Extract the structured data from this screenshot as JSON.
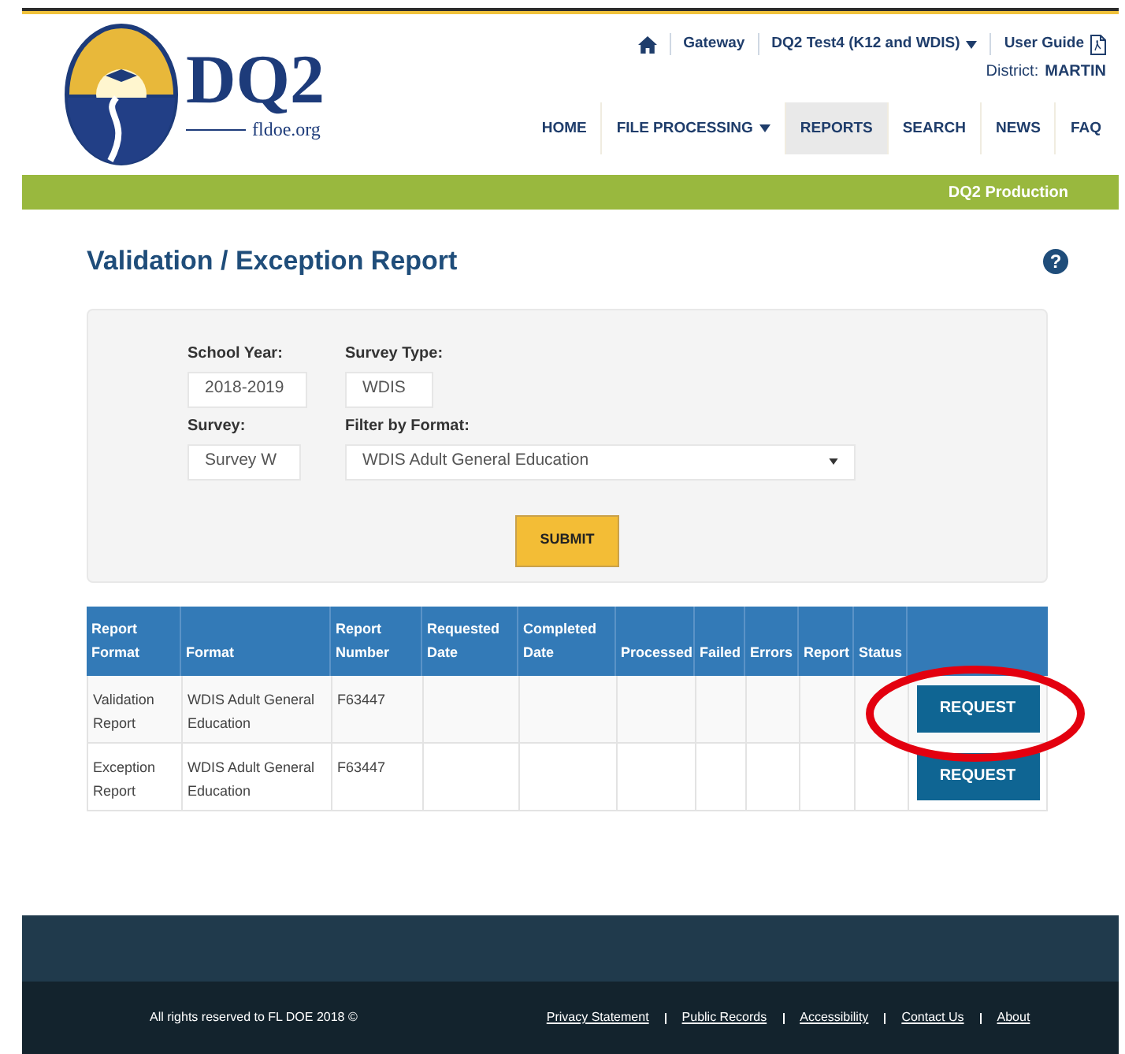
{
  "header": {
    "logo": {
      "title": "DQ2",
      "site": "fldoe.org"
    },
    "top_links": [
      {
        "kind": "home"
      },
      {
        "kind": "link",
        "label": "Gateway"
      },
      {
        "kind": "dropdown",
        "label": "DQ2 Test4 (K12 and WDIS)"
      },
      {
        "kind": "pdf",
        "label": "User Guide"
      }
    ],
    "district_label": "District:",
    "district": "MARTIN",
    "nav": [
      {
        "label": "HOME",
        "selected": false,
        "dropdown": false
      },
      {
        "label": "FILE PROCESSING",
        "selected": false,
        "dropdown": true
      },
      {
        "label": "REPORTS",
        "selected": true,
        "dropdown": false
      },
      {
        "label": "SEARCH",
        "selected": false,
        "dropdown": false
      },
      {
        "label": "NEWS",
        "selected": false,
        "dropdown": false
      },
      {
        "label": "FAQ",
        "selected": false,
        "dropdown": false
      }
    ]
  },
  "banner": "DQ2 Production",
  "page_title": "Validation / Exception Report",
  "help": "?",
  "form": {
    "school_year": {
      "label": "School Year:",
      "value": "2018-2019"
    },
    "survey_type": {
      "label": "Survey Type:",
      "value": "WDIS"
    },
    "survey": {
      "label": "Survey:",
      "value": "Survey W"
    },
    "filter": {
      "label": "Filter by Format:",
      "value": "WDIS Adult General Education"
    },
    "submit": "SUBMIT"
  },
  "table": {
    "columns": [
      "Report Format",
      "Format",
      "Report Number",
      "Requested Date",
      "Completed Date",
      "Processed",
      "Failed",
      "Errors",
      "Report",
      "Status"
    ],
    "rows": [
      {
        "cells": [
          "Validation Report",
          "WDIS Adult General Education",
          "F63447",
          "",
          "",
          "",
          "",
          "",
          "",
          ""
        ],
        "action": "REQUEST",
        "highlighted": true
      },
      {
        "cells": [
          "Exception Report",
          "WDIS Adult General Education",
          "F63447",
          "",
          "",
          "",
          "",
          "",
          "",
          ""
        ],
        "action": "REQUEST",
        "highlighted": false
      }
    ]
  },
  "footer": {
    "copyright": "All rights reserved to FL DOE 2018 ©",
    "links": [
      "Privacy Statement",
      "Public Records",
      "Accessibility",
      "Contact Us",
      "About"
    ]
  }
}
